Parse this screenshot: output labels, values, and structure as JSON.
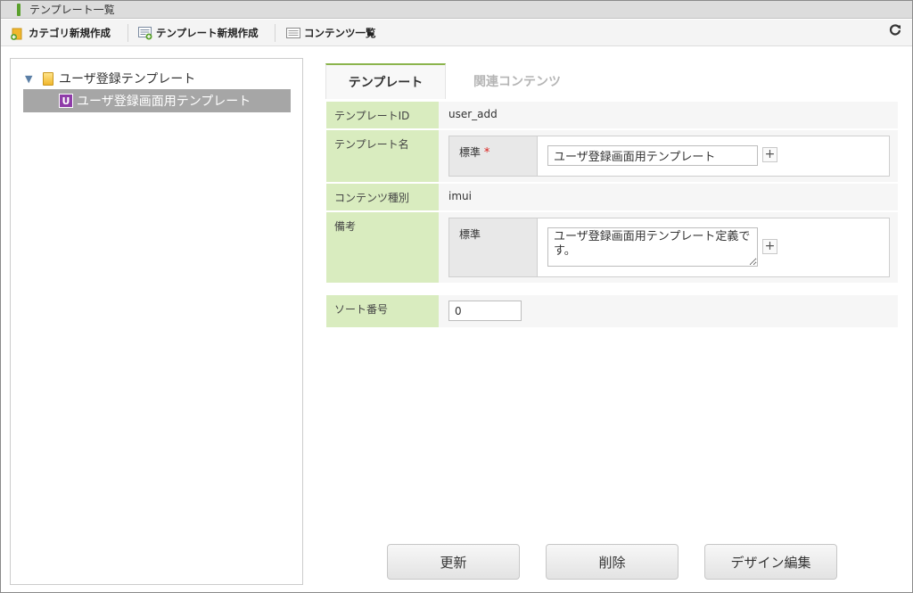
{
  "window": {
    "title": "テンプレート一覧"
  },
  "toolbar": {
    "new_category": "カテゴリ新規作成",
    "new_template": "テンプレート新規作成",
    "content_list": "コンテンツ一覧"
  },
  "tree": {
    "root_label": "ユーザ登録テンプレート",
    "child_label": "ユーザ登録画面用テンプレート",
    "child_badge": "U"
  },
  "tabs": [
    {
      "label": "テンプレート",
      "active": true
    },
    {
      "label": "関連コンテンツ",
      "active": false
    }
  ],
  "form": {
    "template_id": {
      "label": "テンプレートID",
      "value": "user_add"
    },
    "template_name": {
      "label": "テンプレート名",
      "sub_label": "標準",
      "required_mark": "*",
      "value": "ユーザ登録画面用テンプレート"
    },
    "content_type": {
      "label": "コンテンツ種別",
      "value": "imui"
    },
    "notes": {
      "label": "備考",
      "sub_label": "標準",
      "value": "ユーザ登録画面用テンプレート定義です。"
    },
    "sort_number": {
      "label": "ソート番号",
      "value": "0"
    }
  },
  "buttons": {
    "update": "更新",
    "delete": "削除",
    "design_edit": "デザイン編集"
  },
  "colors": {
    "label_bg": "#d9ecbf",
    "tab_accent": "#8bb44c",
    "selected_node_bg": "#a6a6a6",
    "badge_bg": "#8e3ba8"
  }
}
